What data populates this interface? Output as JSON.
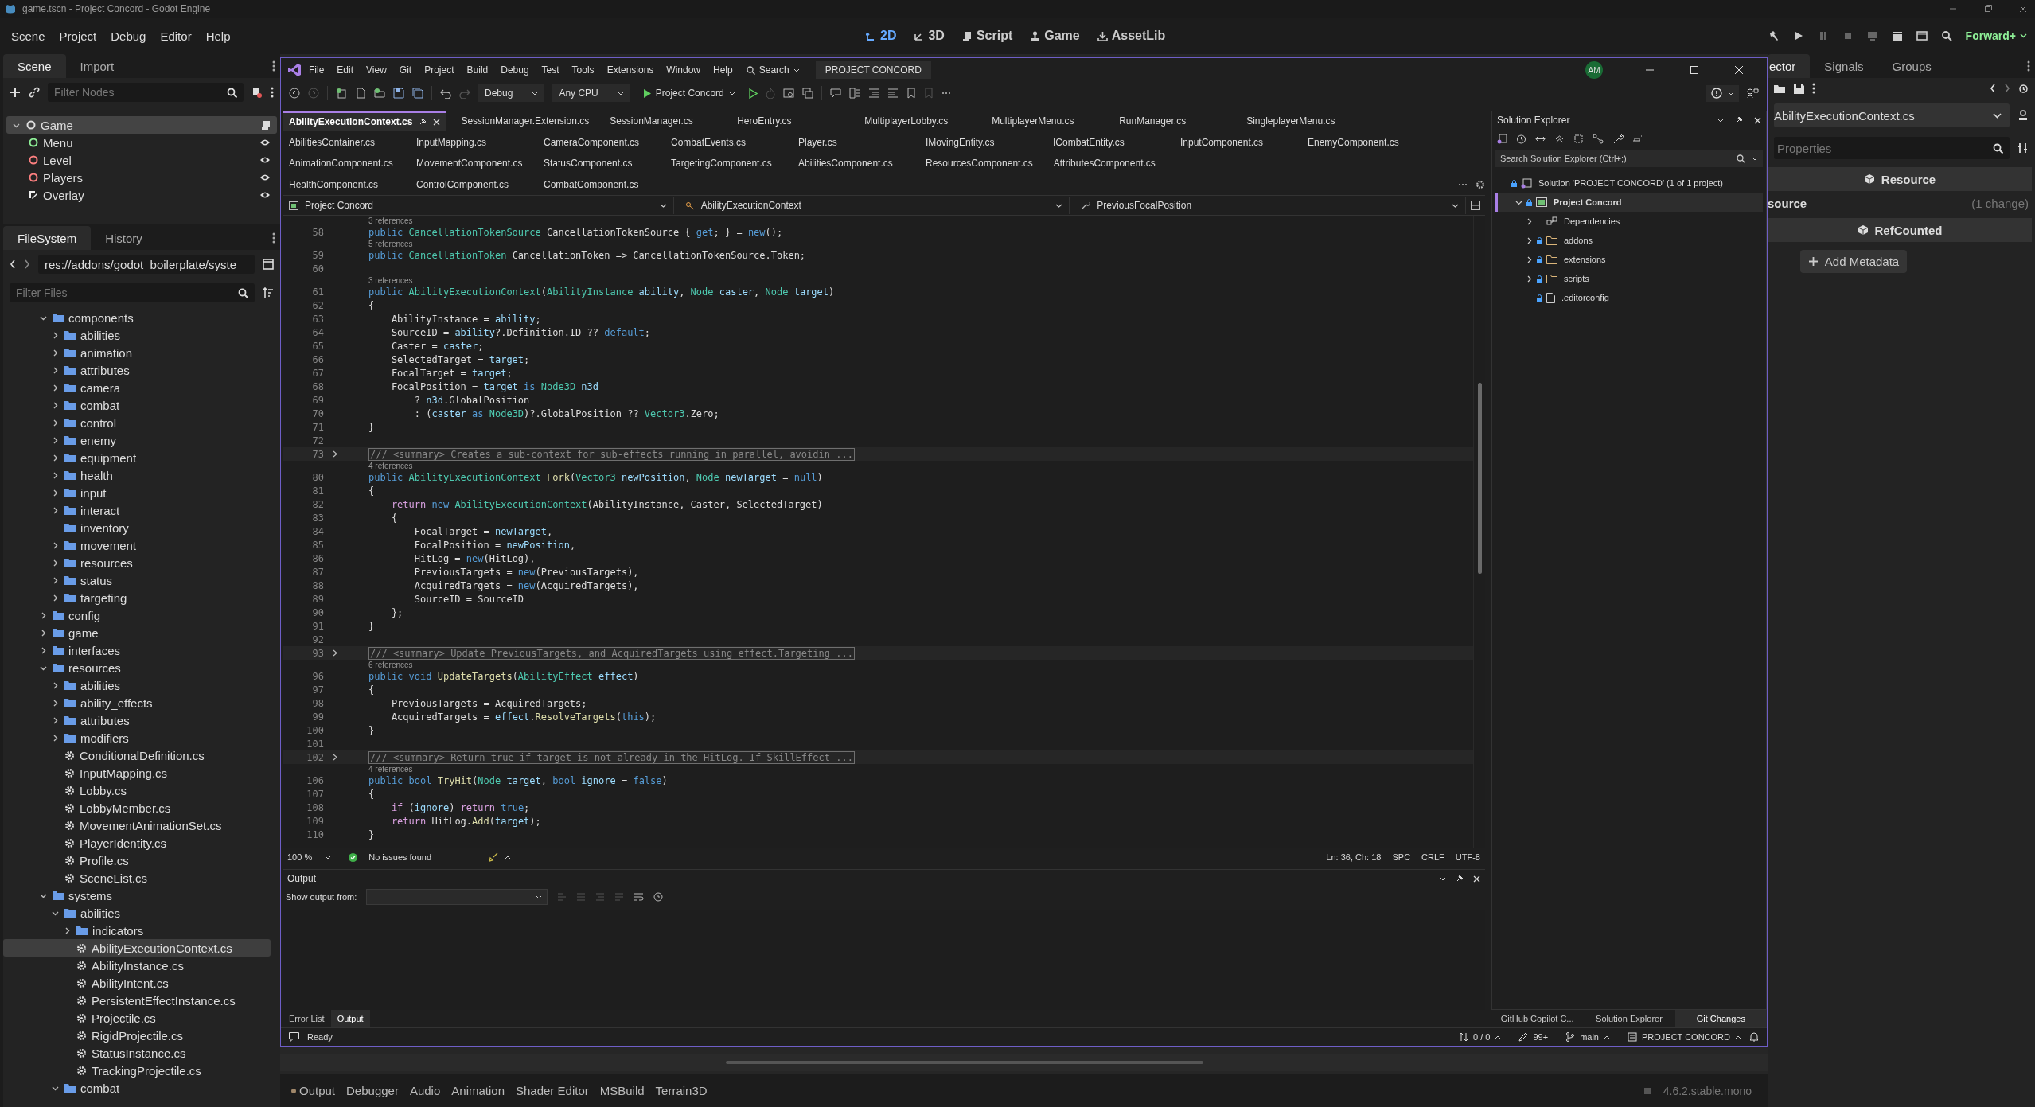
{
  "window": {
    "title": "game.tscn - Project Concord - Godot Engine"
  },
  "menu": [
    "Scene",
    "Project",
    "Debug",
    "Editor",
    "Help"
  ],
  "main_screens": [
    {
      "label": "2D",
      "kind": "canvas",
      "selected": true
    },
    {
      "label": "3D",
      "kind": "spatial",
      "selected": false
    },
    {
      "label": "Script",
      "kind": "script",
      "selected": false
    },
    {
      "label": "Game",
      "kind": "game",
      "selected": false
    },
    {
      "label": "AssetLib",
      "kind": "assetlib",
      "selected": false
    }
  ],
  "renderer": "Forward+",
  "scene": {
    "tabs": [
      {
        "label": "Scene",
        "selected": true
      },
      {
        "label": "Import",
        "selected": false
      }
    ],
    "filter_placeholder": "Filter Nodes",
    "nodes": [
      {
        "name": "Game",
        "kind": "root",
        "selected": true,
        "script": true,
        "expanded": true,
        "children": [
          {
            "name": "Menu",
            "kind": "control",
            "selected": false,
            "visible": true
          },
          {
            "name": "Level",
            "kind": "node3d",
            "selected": false,
            "visible": true
          },
          {
            "name": "Players",
            "kind": "node3d",
            "selected": false,
            "visible": true
          },
          {
            "name": "Overlay",
            "kind": "layer",
            "selected": false,
            "visible": true
          }
        ]
      }
    ]
  },
  "filesystem": {
    "tabs": [
      {
        "label": "FileSystem",
        "selected": true
      },
      {
        "label": "History",
        "selected": false
      }
    ],
    "path": "res://addons/godot_boilerplate/syste",
    "filter_placeholder": "Filter Files",
    "tree": [
      {
        "name": "components",
        "kind": "folder",
        "expanded": true,
        "selected": false,
        "children": [
          {
            "name": "abilities",
            "kind": "folder",
            "expanded": false,
            "selected": false
          },
          {
            "name": "animation",
            "kind": "folder",
            "expanded": false,
            "selected": false
          },
          {
            "name": "attributes",
            "kind": "folder",
            "expanded": false,
            "selected": false
          },
          {
            "name": "camera",
            "kind": "folder",
            "expanded": false,
            "selected": false
          },
          {
            "name": "combat",
            "kind": "folder",
            "expanded": false,
            "selected": false
          },
          {
            "name": "control",
            "kind": "folder",
            "expanded": false,
            "selected": false
          },
          {
            "name": "enemy",
            "kind": "folder",
            "expanded": false,
            "selected": false
          },
          {
            "name": "equipment",
            "kind": "folder",
            "expanded": false,
            "selected": false
          },
          {
            "name": "health",
            "kind": "folder",
            "expanded": false,
            "selected": false
          },
          {
            "name": "input",
            "kind": "folder",
            "expanded": false,
            "selected": false
          },
          {
            "name": "interact",
            "kind": "folder",
            "expanded": false,
            "selected": false
          },
          {
            "name": "inventory",
            "kind": "empty",
            "selected": false
          },
          {
            "name": "movement",
            "kind": "folder",
            "expanded": false,
            "selected": false
          },
          {
            "name": "resources",
            "kind": "folder",
            "expanded": false,
            "selected": false
          },
          {
            "name": "status",
            "kind": "folder",
            "expanded": false,
            "selected": false
          },
          {
            "name": "targeting",
            "kind": "folder",
            "expanded": false,
            "selected": false
          }
        ]
      },
      {
        "name": "config",
        "kind": "folder",
        "expanded": false,
        "selected": false
      },
      {
        "name": "game",
        "kind": "folder",
        "expanded": false,
        "selected": false
      },
      {
        "name": "interfaces",
        "kind": "folder",
        "expanded": false,
        "selected": false
      },
      {
        "name": "resources",
        "kind": "folder",
        "expanded": true,
        "selected": false,
        "children": [
          {
            "name": "abilities",
            "kind": "folder",
            "expanded": false,
            "selected": false
          },
          {
            "name": "ability_effects",
            "kind": "folder",
            "expanded": false,
            "selected": false
          },
          {
            "name": "attributes",
            "kind": "folder",
            "expanded": false,
            "selected": false
          },
          {
            "name": "modifiers",
            "kind": "folder",
            "expanded": false,
            "selected": false
          },
          {
            "name": "ConditionalDefinition.cs",
            "kind": "script",
            "selected": false
          },
          {
            "name": "InputMapping.cs",
            "kind": "script",
            "selected": false
          },
          {
            "name": "Lobby.cs",
            "kind": "script",
            "selected": false
          },
          {
            "name": "LobbyMember.cs",
            "kind": "script",
            "selected": false
          },
          {
            "name": "MovementAnimationSet.cs",
            "kind": "script",
            "selected": false
          },
          {
            "name": "PlayerIdentity.cs",
            "kind": "script",
            "selected": false
          },
          {
            "name": "Profile.cs",
            "kind": "script",
            "selected": false
          },
          {
            "name": "SceneList.cs",
            "kind": "script",
            "selected": false
          }
        ]
      },
      {
        "name": "systems",
        "kind": "folder",
        "expanded": true,
        "selected": false,
        "children": [
          {
            "name": "abilities",
            "kind": "folder",
            "expanded": true,
            "selected": false,
            "children": [
              {
                "name": "indicators",
                "kind": "folder",
                "expanded": false,
                "selected": false
              },
              {
                "name": "AbilityExecutionContext.cs",
                "kind": "script",
                "selected": true
              },
              {
                "name": "AbilityInstance.cs",
                "kind": "script",
                "selected": false
              },
              {
                "name": "AbilityIntent.cs",
                "kind": "script",
                "selected": false
              },
              {
                "name": "PersistentEffectInstance.cs",
                "kind": "script",
                "selected": false
              },
              {
                "name": "Projectile.cs",
                "kind": "script",
                "selected": false
              },
              {
                "name": "RigidProjectile.cs",
                "kind": "script",
                "selected": false
              },
              {
                "name": "StatusInstance.cs",
                "kind": "script",
                "selected": false
              },
              {
                "name": "TrackingProjectile.cs",
                "kind": "script",
                "selected": false
              }
            ]
          },
          {
            "name": "combat",
            "kind": "folder",
            "expanded": true,
            "selected": false
          }
        ]
      }
    ]
  },
  "inspector": {
    "tabs": [
      {
        "label": "ector",
        "selected": true
      },
      {
        "label": "Signals",
        "selected": false
      },
      {
        "label": "Groups",
        "selected": false
      }
    ],
    "resource": "AbilityExecutionContext.cs",
    "filter_placeholder": "Properties",
    "rows": [
      {
        "kind": "section",
        "label": "Resource"
      },
      {
        "kind": "property",
        "label": "source",
        "value": "(1 change)"
      },
      {
        "kind": "section",
        "label": "RefCounted"
      }
    ],
    "add_metadata": "Add Metadata"
  },
  "bottom_panel": {
    "tabs": [
      {
        "label": "Output",
        "notification": true
      },
      {
        "label": "Debugger",
        "notification": false
      },
      {
        "label": "Audio",
        "notification": false
      },
      {
        "label": "Animation",
        "notification": false
      },
      {
        "label": "Shader Editor",
        "notification": false
      },
      {
        "label": "MSBuild",
        "notification": false
      },
      {
        "label": "Terrain3D",
        "notification": false
      }
    ],
    "version": "4.6.2.stable.mono"
  },
  "vs": {
    "menu": [
      "File",
      "Edit",
      "View",
      "Git",
      "Project",
      "Build",
      "Debug",
      "Test",
      "Tools",
      "Extensions",
      "Window",
      "Help"
    ],
    "search": "Search",
    "solution_badge": "PROJECT CONCORD",
    "account_initials": "AM",
    "configuration": "Debug",
    "platform": "Any CPU",
    "startup": "Project Concord",
    "tab_rows": [
      [
        {
          "label": "AbilityExecutionContext.cs",
          "selected": true
        },
        {
          "label": "SessionManager.Extension.cs",
          "selected": false
        },
        {
          "label": "SessionManager.cs",
          "selected": false
        },
        {
          "label": "HeroEntry.cs",
          "selected": false
        },
        {
          "label": "MultiplayerLobby.cs",
          "selected": false
        },
        {
          "label": "MultiplayerMenu.cs",
          "selected": false
        },
        {
          "label": "RunManager.cs",
          "selected": false
        },
        {
          "label": "SingleplayerMenu.cs",
          "selected": false
        }
      ],
      [
        {
          "label": "AbilitiesContainer.cs",
          "selected": false
        },
        {
          "label": "InputMapping.cs",
          "selected": false
        },
        {
          "label": "CameraComponent.cs",
          "selected": false
        },
        {
          "label": "CombatEvents.cs",
          "selected": false
        },
        {
          "label": "Player.cs",
          "selected": false
        },
        {
          "label": "IMovingEntity.cs",
          "selected": false
        },
        {
          "label": "ICombatEntity.cs",
          "selected": false
        },
        {
          "label": "InputComponent.cs",
          "selected": false
        },
        {
          "label": "EnemyComponent.cs",
          "selected": false
        }
      ],
      [
        {
          "label": "AnimationComponent.cs",
          "selected": false
        },
        {
          "label": "MovementComponent.cs",
          "selected": false
        },
        {
          "label": "StatusComponent.cs",
          "selected": false
        },
        {
          "label": "TargetingComponent.cs",
          "selected": false
        },
        {
          "label": "AbilitiesComponent.cs",
          "selected": false
        },
        {
          "label": "ResourcesComponent.cs",
          "selected": false
        },
        {
          "label": "AttributesComponent.cs",
          "selected": false
        }
      ],
      [
        {
          "label": "HealthComponent.cs",
          "selected": false
        },
        {
          "label": "ControlComponent.cs",
          "selected": false
        },
        {
          "label": "CombatComponent.cs",
          "selected": false
        }
      ]
    ],
    "navigation": [
      "Project Concord",
      "AbilityExecutionContext",
      "PreviousFocalPosition"
    ],
    "code": [
      {
        "number": "58",
        "references": "3 references",
        "tokens": [
          {
            "kind": "kw",
            "text": "public "
          },
          {
            "kind": "type",
            "text": "CancellationTokenSource"
          },
          {
            "kind": "text",
            "text": " CancellationTokenSource { "
          },
          {
            "kind": "kw",
            "text": "get"
          },
          {
            "kind": "text",
            "text": "; } = "
          },
          {
            "kind": "kw",
            "text": "new"
          },
          {
            "kind": "text",
            "text": "();"
          }
        ]
      },
      {
        "number": "59",
        "references": "5 references",
        "tokens": [
          {
            "kind": "kw",
            "text": "public "
          },
          {
            "kind": "type",
            "text": "CancellationToken"
          },
          {
            "kind": "text",
            "text": " CancellationToken => CancellationTokenSource.Token;"
          }
        ]
      },
      {
        "number": "60"
      },
      {
        "number": "61",
        "references": "3 references",
        "tokens": [
          {
            "kind": "kw",
            "text": "public "
          },
          {
            "kind": "type",
            "text": "AbilityExecutionContext"
          },
          {
            "kind": "text",
            "text": "("
          },
          {
            "kind": "type",
            "text": "AbilityInstance"
          },
          {
            "kind": "var",
            "text": " ability"
          },
          {
            "kind": "text",
            "text": ", "
          },
          {
            "kind": "type",
            "text": "Node"
          },
          {
            "kind": "var",
            "text": " caster"
          },
          {
            "kind": "text",
            "text": ", "
          },
          {
            "kind": "type",
            "text": "Node"
          },
          {
            "kind": "var",
            "text": " target"
          },
          {
            "kind": "text",
            "text": ")"
          }
        ]
      },
      {
        "number": "62",
        "tokens": [
          {
            "kind": "text",
            "text": "{"
          }
        ]
      },
      {
        "number": "63",
        "tokens": [
          {
            "kind": "text",
            "text": "    AbilityInstance = "
          },
          {
            "kind": "var",
            "text": "ability"
          },
          {
            "kind": "text",
            "text": ";"
          }
        ]
      },
      {
        "number": "64",
        "tokens": [
          {
            "kind": "text",
            "text": "    SourceID = "
          },
          {
            "kind": "var",
            "text": "ability"
          },
          {
            "kind": "text",
            "text": "?.Definition.ID ?? "
          },
          {
            "kind": "kw",
            "text": "default"
          },
          {
            "kind": "text",
            "text": ";"
          }
        ]
      },
      {
        "number": "65",
        "tokens": [
          {
            "kind": "text",
            "text": "    Caster = "
          },
          {
            "kind": "var",
            "text": "caster"
          },
          {
            "kind": "text",
            "text": ";"
          }
        ]
      },
      {
        "number": "66",
        "tokens": [
          {
            "kind": "text",
            "text": "    SelectedTarget = "
          },
          {
            "kind": "var",
            "text": "target"
          },
          {
            "kind": "text",
            "text": ";"
          }
        ]
      },
      {
        "number": "67",
        "tokens": [
          {
            "kind": "text",
            "text": "    FocalTarget = "
          },
          {
            "kind": "var",
            "text": "target"
          },
          {
            "kind": "text",
            "text": ";"
          }
        ]
      },
      {
        "number": "68",
        "tokens": [
          {
            "kind": "text",
            "text": "    FocalPosition = "
          },
          {
            "kind": "var",
            "text": "target"
          },
          {
            "kind": "kw",
            "text": " is "
          },
          {
            "kind": "type",
            "text": "Node3D"
          },
          {
            "kind": "var",
            "text": " n3d"
          }
        ]
      },
      {
        "number": "69",
        "tokens": [
          {
            "kind": "text",
            "text": "        ? "
          },
          {
            "kind": "var",
            "text": "n3d"
          },
          {
            "kind": "text",
            "text": ".GlobalPosition"
          }
        ]
      },
      {
        "number": "70",
        "tokens": [
          {
            "kind": "text",
            "text": "        : ("
          },
          {
            "kind": "var",
            "text": "caster"
          },
          {
            "kind": "kw",
            "text": " as "
          },
          {
            "kind": "type",
            "text": "Node3D"
          },
          {
            "kind": "text",
            "text": ")?.GlobalPosition ?? "
          },
          {
            "kind": "type",
            "text": "Vector3"
          },
          {
            "kind": "text",
            "text": ".Zero;"
          }
        ]
      },
      {
        "number": "71",
        "tokens": [
          {
            "kind": "text",
            "text": "}"
          }
        ]
      },
      {
        "number": "72"
      },
      {
        "number": "73",
        "folded": "/// <summary> Creates a sub-context for sub-effects running in parallel, avoidin ..."
      },
      {
        "number": "80",
        "references": "4 references",
        "tokens": [
          {
            "kind": "kw",
            "text": "public "
          },
          {
            "kind": "type",
            "text": "AbilityExecutionContext"
          },
          {
            "kind": "method",
            "text": " Fork"
          },
          {
            "kind": "text",
            "text": "("
          },
          {
            "kind": "type",
            "text": "Vector3"
          },
          {
            "kind": "var",
            "text": " newPosition"
          },
          {
            "kind": "text",
            "text": ", "
          },
          {
            "kind": "type",
            "text": "Node"
          },
          {
            "kind": "var",
            "text": " newTarget"
          },
          {
            "kind": "text",
            "text": " = "
          },
          {
            "kind": "kw",
            "text": "null"
          },
          {
            "kind": "text",
            "text": ")"
          }
        ]
      },
      {
        "number": "81",
        "tokens": [
          {
            "kind": "text",
            "text": "{"
          }
        ]
      },
      {
        "number": "82",
        "tokens": [
          {
            "kind": "ctrl",
            "text": "    return "
          },
          {
            "kind": "kw",
            "text": "new "
          },
          {
            "kind": "type",
            "text": "AbilityExecutionContext"
          },
          {
            "kind": "text",
            "text": "(AbilityInstance, Caster, SelectedTarget)"
          }
        ]
      },
      {
        "number": "83",
        "tokens": [
          {
            "kind": "text",
            "text": "    {"
          }
        ]
      },
      {
        "number": "84",
        "tokens": [
          {
            "kind": "text",
            "text": "        FocalTarget = "
          },
          {
            "kind": "var",
            "text": "newTarget"
          },
          {
            "kind": "text",
            "text": ","
          }
        ]
      },
      {
        "number": "85",
        "tokens": [
          {
            "kind": "text",
            "text": "        FocalPosition = "
          },
          {
            "kind": "var",
            "text": "newPosition"
          },
          {
            "kind": "text",
            "text": ","
          }
        ]
      },
      {
        "number": "86",
        "tokens": [
          {
            "kind": "text",
            "text": "        HitLog = "
          },
          {
            "kind": "kw",
            "text": "new"
          },
          {
            "kind": "text",
            "text": "(HitLog),"
          }
        ]
      },
      {
        "number": "87",
        "tokens": [
          {
            "kind": "text",
            "text": "        PreviousTargets = "
          },
          {
            "kind": "kw",
            "text": "new"
          },
          {
            "kind": "text",
            "text": "(PreviousTargets),"
          }
        ]
      },
      {
        "number": "88",
        "tokens": [
          {
            "kind": "text",
            "text": "        AcquiredTargets = "
          },
          {
            "kind": "kw",
            "text": "new"
          },
          {
            "kind": "text",
            "text": "(AcquiredTargets),"
          }
        ]
      },
      {
        "number": "89",
        "tokens": [
          {
            "kind": "text",
            "text": "        SourceID = SourceID"
          }
        ]
      },
      {
        "number": "90",
        "tokens": [
          {
            "kind": "text",
            "text": "    };"
          }
        ]
      },
      {
        "number": "91",
        "tokens": [
          {
            "kind": "text",
            "text": "}"
          }
        ]
      },
      {
        "number": "92"
      },
      {
        "number": "93",
        "folded": "/// <summary> Update PreviousTargets, and AcquiredTargets using effect.Targeting ..."
      },
      {
        "number": "96",
        "references": "6 references",
        "tokens": [
          {
            "kind": "kw",
            "text": "public void "
          },
          {
            "kind": "method",
            "text": "UpdateTargets"
          },
          {
            "kind": "text",
            "text": "("
          },
          {
            "kind": "type",
            "text": "AbilityEffect"
          },
          {
            "kind": "var",
            "text": " effect"
          },
          {
            "kind": "text",
            "text": ")"
          }
        ]
      },
      {
        "number": "97",
        "tokens": [
          {
            "kind": "text",
            "text": "{"
          }
        ]
      },
      {
        "number": "98",
        "tokens": [
          {
            "kind": "text",
            "text": "    PreviousTargets = AcquiredTargets;"
          }
        ]
      },
      {
        "number": "99",
        "tokens": [
          {
            "kind": "text",
            "text": "    AcquiredTargets = "
          },
          {
            "kind": "var",
            "text": "effect"
          },
          {
            "kind": "text",
            "text": "."
          },
          {
            "kind": "method",
            "text": "ResolveTargets"
          },
          {
            "kind": "text",
            "text": "("
          },
          {
            "kind": "kw",
            "text": "this"
          },
          {
            "kind": "text",
            "text": ");"
          }
        ]
      },
      {
        "number": "100",
        "tokens": [
          {
            "kind": "text",
            "text": "}"
          }
        ]
      },
      {
        "number": "101"
      },
      {
        "number": "102",
        "folded": "/// <summary> Return true if target is not already in the HitLog. If SkillEffect ..."
      },
      {
        "number": "106",
        "references": "4 references",
        "tokens": [
          {
            "kind": "kw",
            "text": "public bool "
          },
          {
            "kind": "method",
            "text": "TryHit"
          },
          {
            "kind": "text",
            "text": "("
          },
          {
            "kind": "type",
            "text": "Node"
          },
          {
            "kind": "var",
            "text": " target"
          },
          {
            "kind": "text",
            "text": ", "
          },
          {
            "kind": "kw",
            "text": "bool "
          },
          {
            "kind": "var",
            "text": "ignore"
          },
          {
            "kind": "text",
            "text": " = "
          },
          {
            "kind": "kw",
            "text": "false"
          },
          {
            "kind": "text",
            "text": ")"
          }
        ]
      },
      {
        "number": "107",
        "tokens": [
          {
            "kind": "text",
            "text": "{"
          }
        ]
      },
      {
        "number": "108",
        "tokens": [
          {
            "kind": "ctrl",
            "text": "    if"
          },
          {
            "kind": "text",
            "text": " ("
          },
          {
            "kind": "var",
            "text": "ignore"
          },
          {
            "kind": "text",
            "text": ") "
          },
          {
            "kind": "ctrl",
            "text": "return "
          },
          {
            "kind": "kw",
            "text": "true"
          },
          {
            "kind": "text",
            "text": ";"
          }
        ]
      },
      {
        "number": "109",
        "tokens": [
          {
            "kind": "ctrl",
            "text": "    return "
          },
          {
            "kind": "text",
            "text": "HitLog."
          },
          {
            "kind": "method",
            "text": "Add"
          },
          {
            "kind": "text",
            "text": "("
          },
          {
            "kind": "var",
            "text": "target"
          },
          {
            "kind": "text",
            "text": ");"
          }
        ]
      },
      {
        "number": "110",
        "tokens": [
          {
            "kind": "text",
            "text": "}"
          }
        ]
      }
    ],
    "editor_status": {
      "zoom": "100 %",
      "issues": "No issues found",
      "position": "Ln: 36, Ch: 18",
      "indent": "SPC",
      "line_endings": "CRLF",
      "encoding": "UTF-8"
    },
    "output": {
      "title": "Output",
      "source_label": "Show output from:"
    },
    "lower_tabs": [
      {
        "label": "Error List",
        "selected": false
      },
      {
        "label": "Output",
        "selected": true
      }
    ],
    "solution_explorer": {
      "title": "Solution Explorer",
      "search_placeholder": "Search Solution Explorer (Ctrl+;)",
      "tree": [
        {
          "label": "Solution 'PROJECT CONCORD' (1 of 1 project)",
          "kind": "solution",
          "locked": true,
          "selected": false,
          "children": [
            {
              "label": "Project Concord",
              "kind": "project",
              "locked": true,
              "selected": true,
              "expanded": true,
              "children": [
                {
                  "label": "Dependencies",
                  "kind": "dependencies",
                  "locked": false,
                  "selected": false,
                  "expanded": false
                },
                {
                  "label": "addons",
                  "kind": "folder",
                  "locked": true,
                  "selected": false,
                  "expanded": false
                },
                {
                  "label": "extensions",
                  "kind": "folder",
                  "locked": true,
                  "selected": false,
                  "expanded": false
                },
                {
                  "label": "scripts",
                  "kind": "folder",
                  "locked": true,
                  "selected": false,
                  "expanded": false
                },
                {
                  "label": ".editorconfig",
                  "kind": "file",
                  "locked": true,
                  "selected": false
                }
              ]
            }
          ]
        }
      ]
    },
    "side_tabs": [
      {
        "label": "GitHub Copilot C...",
        "selected": false
      },
      {
        "label": "Solution Explorer",
        "selected": false
      },
      {
        "label": "Git Changes",
        "selected": true
      }
    ],
    "status_bar": {
      "state": "Ready",
      "changes": "0 / 0",
      "edits": "99+",
      "branch": "main",
      "repository": "PROJECT CONCORD"
    }
  }
}
